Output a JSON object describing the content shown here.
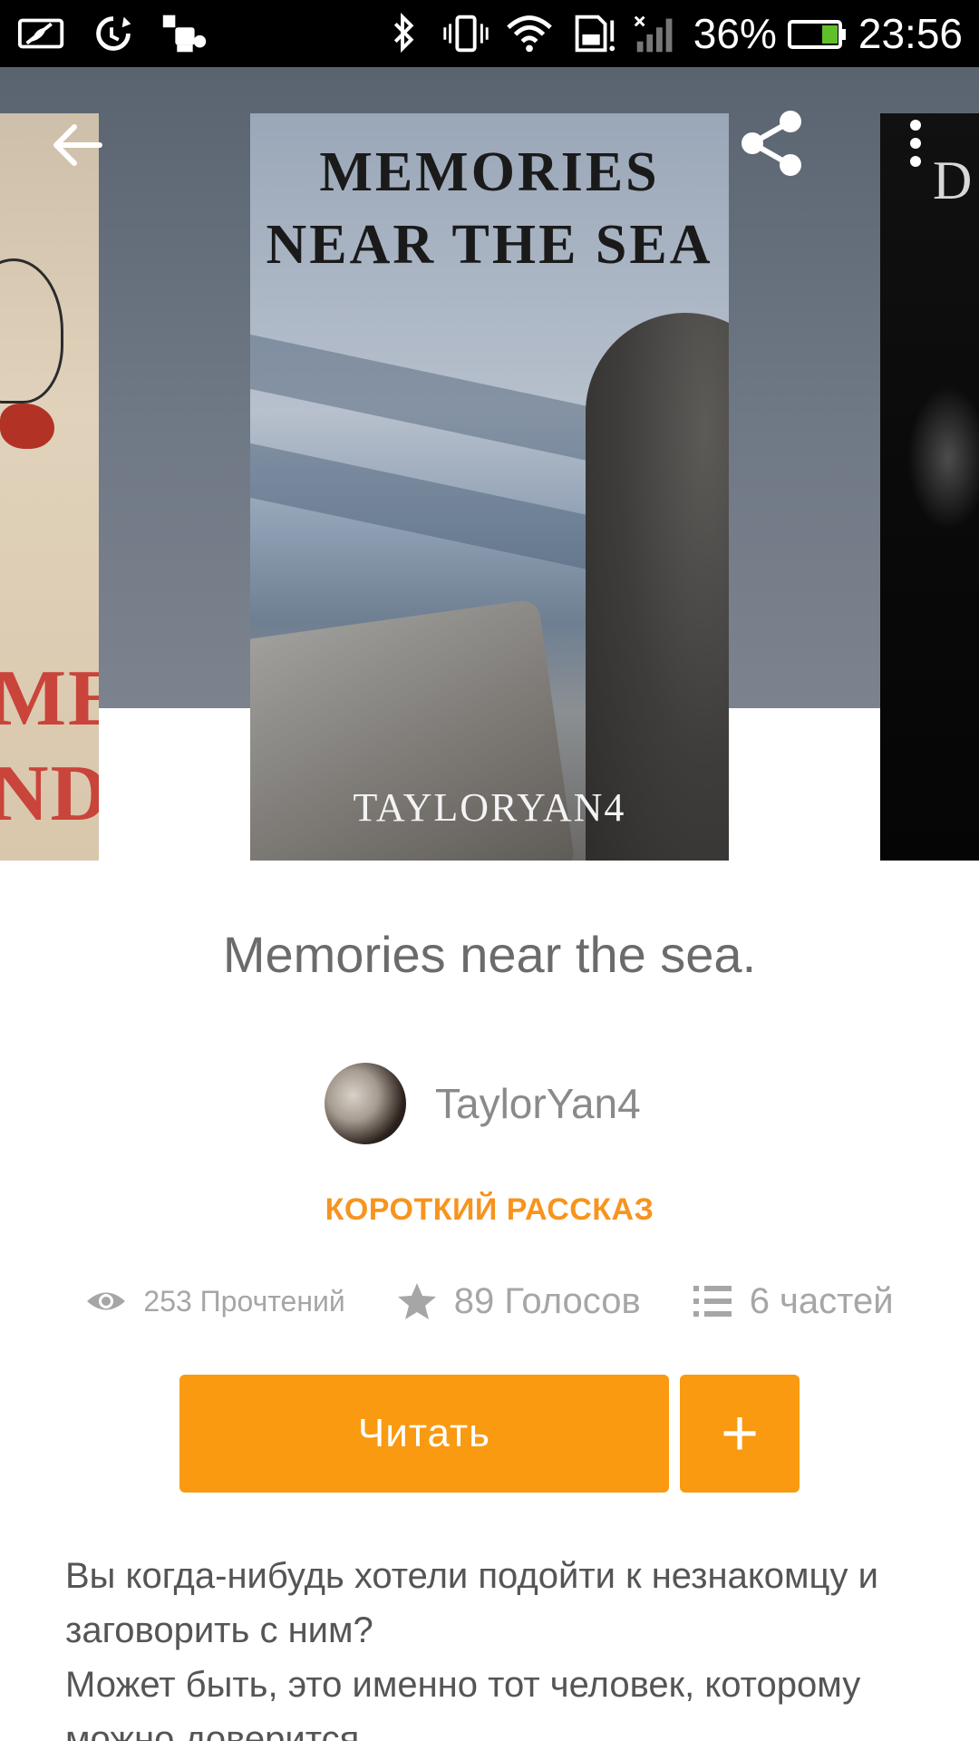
{
  "status_bar": {
    "icons_left": [
      "stamina-mode-icon",
      "sync-icon",
      "puzzle-icon"
    ],
    "icons_right": [
      "bluetooth-icon",
      "vibrate-icon",
      "wifi-icon",
      "sd-card-alert-icon",
      "signal-icon"
    ],
    "battery": "36%",
    "time": "23:56"
  },
  "header": {
    "back_icon": "arrow-left-icon",
    "share_icon": "share-icon",
    "more_icon": "more-vert-icon",
    "cover_main": {
      "title_line1": "MEMORIES",
      "title_line2": "NEAR THE SEA",
      "author": "TAYLORYAN4"
    },
    "cover_left": {
      "text_line1": "ME",
      "text_line2": "ND"
    },
    "cover_right": {
      "letter": "D"
    }
  },
  "book": {
    "title": "Memories near the sea.",
    "author": "TaylorYan4",
    "genre": "КОРОТКИЙ РАССКАЗ",
    "stats": {
      "reads": "253 Прочтений",
      "votes": "89 Голосов",
      "parts": "6 частей"
    },
    "read_label": "Читать",
    "add_label": "+",
    "description": [
      "Вы когда-нибудь хотели подойти к незнакомцу и заговорить с ним?",
      "Может быть, это именно тот человек, которому можно доверится"
    ]
  },
  "colors": {
    "accent": "#f99a11",
    "genre": "#f7941e",
    "text_muted": "#a6a6a6"
  }
}
